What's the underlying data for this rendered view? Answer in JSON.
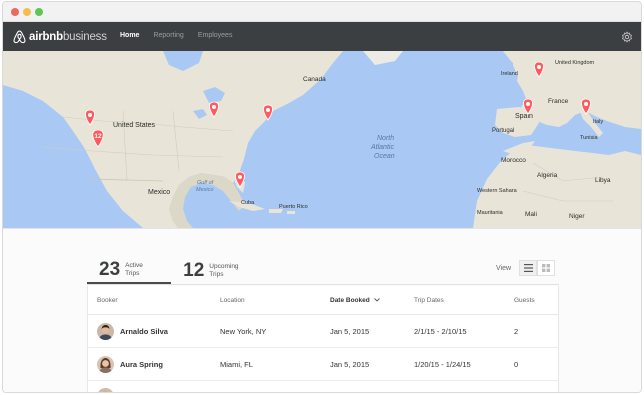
{
  "nav": {
    "brand": "airbnb",
    "brand_sub": "business",
    "links": [
      "Home",
      "Reporting",
      "Employees"
    ]
  },
  "map": {
    "labels": {
      "canada_east": "Canada",
      "united_states": "United States",
      "mexico": "Mexico",
      "gulf": [
        "Gulf of",
        "Mexico"
      ],
      "cuba": "Cuba",
      "puerto_rico": "Puerto Rico",
      "ocean": [
        "North",
        "Atlantic",
        "Ocean"
      ],
      "portugal": "Portugal",
      "spain": "Spain",
      "france": "France",
      "uk": "United Kingdom",
      "morocco": "Morocco",
      "algeria": "Algeria",
      "libya": "Libya",
      "tunisia": "Tunisia",
      "western_sahara": "Western Sahara",
      "mauritania": "Mauritania",
      "mali": "Mali",
      "niger": "Niger",
      "ireland": "Ireland",
      "italy": "Italy"
    },
    "cluster_count": "12",
    "pin_color": "#ff5a5f"
  },
  "stats": [
    {
      "num": "23",
      "label": [
        "Active",
        "Trips"
      ]
    },
    {
      "num": "12",
      "label": [
        "Upcoming",
        "Trips"
      ]
    }
  ],
  "view_label": "View",
  "table": {
    "headers": [
      "Booker",
      "Location",
      "Date Booked",
      "Trip Dates",
      "Guests"
    ],
    "rows": [
      {
        "name": "Arnaldo Silva",
        "location": "New York, NY",
        "booked": "Jan 5, 2015",
        "dates": "2/1/15 - 2/10/15",
        "guests": "2"
      },
      {
        "name": "Aura Spring",
        "location": "Miami, FL",
        "booked": "Jan 5, 2015",
        "dates": "1/20/15 - 1/24/15",
        "guests": "0"
      }
    ]
  }
}
